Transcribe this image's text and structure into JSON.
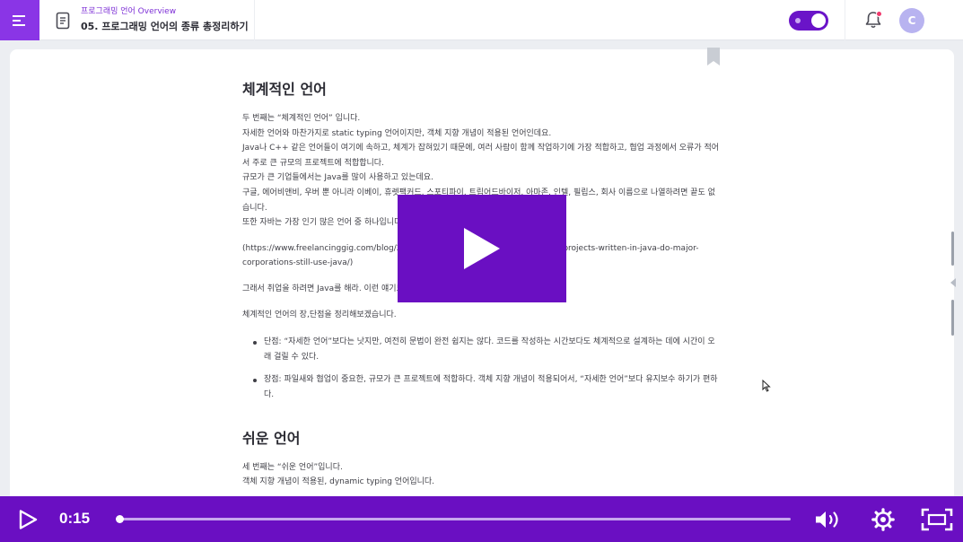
{
  "header": {
    "course_title": "프로그래밍 언어 Overview",
    "lesson_title": "05. 프로그래밍 언어의 종류 총정리하기",
    "icons": [
      "menu-icon",
      "document-icon",
      "toggle-switch",
      "bell-icon",
      "avatar"
    ],
    "notification_badge_color": "#f03a6d",
    "avatar_letter": "C"
  },
  "article": {
    "section1_title": "체계적인 언어",
    "p1": "두 번째는 “체계적인 언어” 입니다.",
    "p2": "자세한 언어와 마찬가지로 static typing 언어이지만, 객체 지향 개념이 적용된 언어인데요.",
    "p3": "Java나 C++ 같은 언어들이 여기에 속하고, 체계가 잡혀있기 때문에, 여러 사람이 함께 작업하기에 가장 적합하고, 협업 과정에서 오류가 적어서 주로 큰 규모의 프로젝트에 적합합니다.",
    "p4": "규모가 큰 기업들에서는 Java를 많이 사용하고 있는데요.",
    "p5": "구글, 에어비앤비, 우버 뿐 아니라 이베이, 휴렛팩커드, 스포티파이, 트립어드바이저, 아마존, 인텔, 필립스, 회사 이름으로 나열하려면 끝도 없습니다.",
    "p6": "또한 자바는 가장 인기 많은 언어 중 하나입니다.",
    "p7": "(https://www.freelancinggig.com/blog/2018/06/04/why-are-so-many-enterprise-projects-written-in-java-do-major-corporations-still-use-java/)",
    "p8": "그래서 취업을 하려면 Java를 해라. 이런 얘기도 많이 합니다.",
    "p9": "체계적인 언어의 장,단점을 정리해보겠습니다.",
    "bullet1": "단점: “자세한 언어”보다는 낫지만, 여전히 문법이 완전 쉽지는 않다. 코드를 작성하는 시간보다도 체계적으로 설계하는 데에 시간이 오래 걸릴 수 있다.",
    "bullet2": "장점: 파일새와 협업이 중요한, 규모가 큰 프로젝트에 적합하다. 객체 지향 개념이 적용되어서, “자세한 언어”보다 유지보수 하기가 편하다.",
    "section2_title": "쉬운 언어",
    "p10": "세 번째는 “쉬운 언어”입니다.",
    "p11": "객체 지향 개념이 적용된, dynamic typing 언어입니다."
  },
  "player": {
    "time": "0:15",
    "progress": 0.002,
    "controls": [
      "play-icon",
      "volume-icon",
      "settings-gear-icon",
      "fullscreen-icon"
    ],
    "accent_color": "#6a0fc2"
  }
}
